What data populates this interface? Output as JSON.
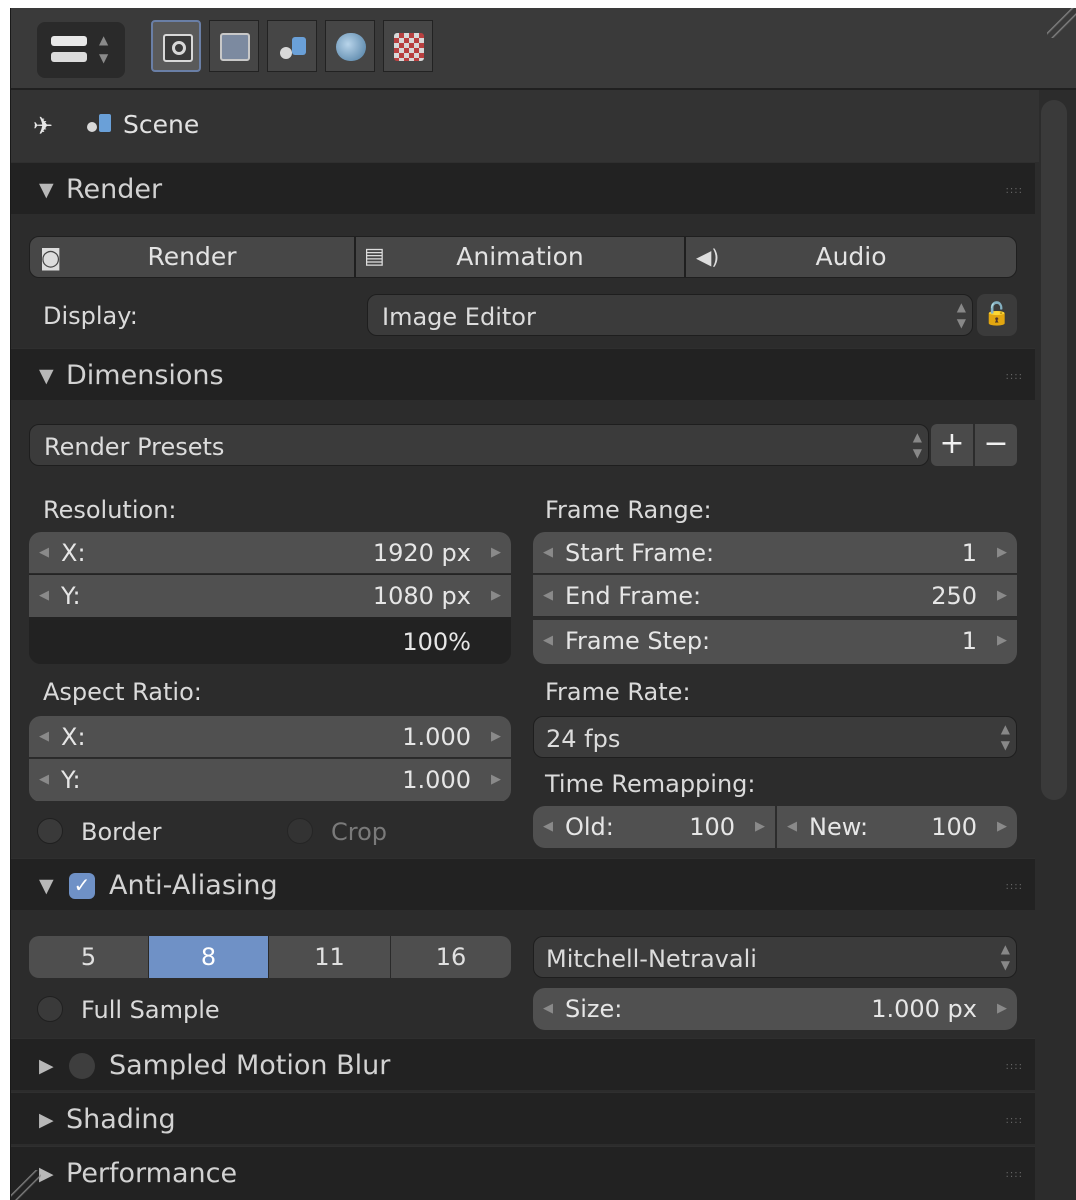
{
  "header": {
    "context_tabs": [
      "render-context",
      "render-layers-context",
      "scene-context",
      "world-context",
      "texture-context"
    ]
  },
  "breadcrumb": {
    "label": "Scene"
  },
  "render_panel": {
    "title": "Render",
    "buttons": [
      "Render",
      "Animation",
      "Audio"
    ],
    "display_label": "Display:",
    "display_value": "Image Editor"
  },
  "dimensions_panel": {
    "title": "Dimensions",
    "presets_label": "Render Presets",
    "add_label": "+",
    "remove_label": "−",
    "resolution_label": "Resolution:",
    "res_x_label": "X:",
    "res_x_value": "1920 px",
    "res_y_label": "Y:",
    "res_y_value": "1080 px",
    "res_percent": "100%",
    "aspect_label": "Aspect Ratio:",
    "aspect_x_label": "X:",
    "aspect_x_value": "1.000",
    "aspect_y_label": "Y:",
    "aspect_y_value": "1.000",
    "border_label": "Border",
    "crop_label": "Crop",
    "frame_range_label": "Frame Range:",
    "start_label": "Start Frame:",
    "start_value": "1",
    "end_label": "End Frame:",
    "end_value": "250",
    "step_label": "Frame Step:",
    "step_value": "1",
    "frame_rate_label": "Frame Rate:",
    "frame_rate_value": "24 fps",
    "time_remap_label": "Time Remapping:",
    "old_label": "Old:",
    "old_value": "100",
    "new_label": "New:",
    "new_value": "100"
  },
  "aa_panel": {
    "title": "Anti-Aliasing",
    "samples": [
      "5",
      "8",
      "11",
      "16"
    ],
    "selected": "8",
    "filter_value": "Mitchell-Netravali",
    "full_sample_label": "Full Sample",
    "size_label": "Size:",
    "size_value": "1.000 px"
  },
  "collapsed_panels": [
    "Sampled Motion Blur",
    "Shading",
    "Performance"
  ],
  "colors": {
    "accent": "#6f91c6",
    "panel_header": "#222222",
    "background": "#2c2c2c"
  }
}
